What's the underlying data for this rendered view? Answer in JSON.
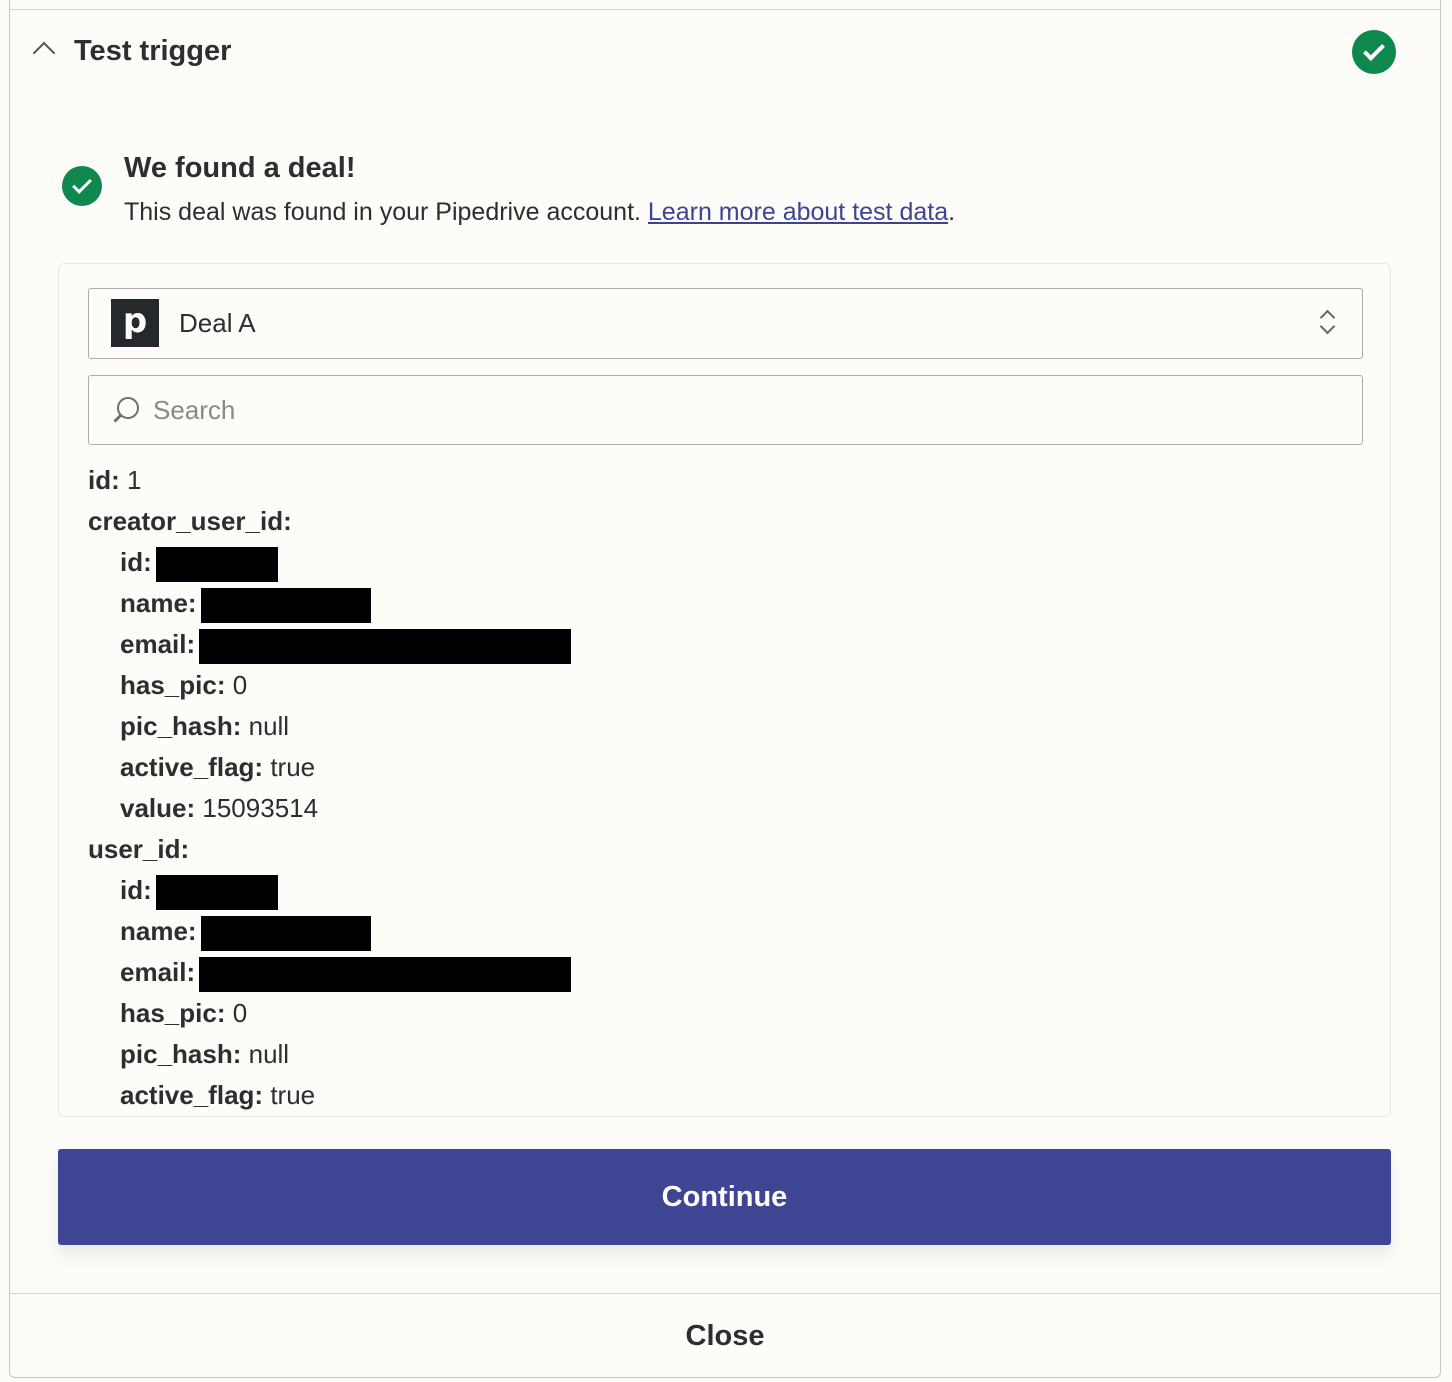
{
  "header": {
    "title": "Test trigger",
    "status": "success",
    "status_color": "#0f884e"
  },
  "result": {
    "title": "We found a deal!",
    "description": "This deal was found in your Pipedrive account. ",
    "link_text": "Learn more about test data",
    "trailing": "."
  },
  "record_select": {
    "app_icon": "pipedrive-logo",
    "app_letter": "p",
    "selected": "Deal A"
  },
  "search": {
    "placeholder": "Search"
  },
  "fields": [
    {
      "key": "id:",
      "value": "1",
      "level": 0
    },
    {
      "key": "creator_user_id:",
      "value": "",
      "level": 0
    },
    {
      "key": "id:",
      "value": "",
      "level": 1,
      "redacted": true
    },
    {
      "key": "name:",
      "value": "",
      "level": 1,
      "redacted": true
    },
    {
      "key": "email:",
      "value": "",
      "level": 1,
      "redacted": true
    },
    {
      "key": "has_pic:",
      "value": "0",
      "level": 1
    },
    {
      "key": "pic_hash:",
      "value": "null",
      "level": 1
    },
    {
      "key": "active_flag:",
      "value": "true",
      "level": 1
    },
    {
      "key": "value:",
      "value": "15093514",
      "level": 1
    },
    {
      "key": "user_id:",
      "value": "",
      "level": 0
    },
    {
      "key": "id:",
      "value": "",
      "level": 1,
      "redacted": true
    },
    {
      "key": "name:",
      "value": "",
      "level": 1,
      "redacted": true
    },
    {
      "key": "email:",
      "value": "",
      "level": 1,
      "redacted": true
    },
    {
      "key": "has_pic:",
      "value": "0",
      "level": 1
    },
    {
      "key": "pic_hash:",
      "value": "null",
      "level": 1
    },
    {
      "key": "active_flag:",
      "value": "true",
      "level": 1
    }
  ],
  "actions": {
    "continue_label": "Continue",
    "close_label": "Close",
    "primary_color": "#3e4593"
  }
}
